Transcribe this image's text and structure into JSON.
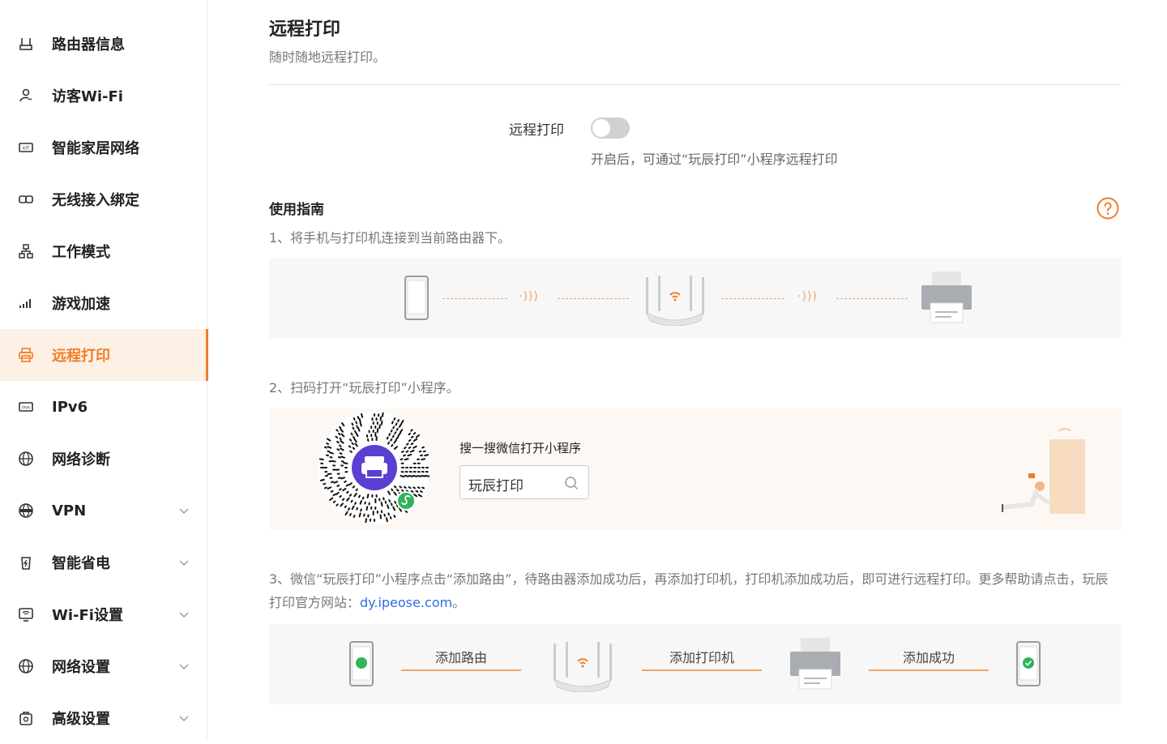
{
  "sidebar": {
    "items": [
      {
        "label": "路由器信息",
        "icon": "router-icon",
        "expandable": false,
        "active": false
      },
      {
        "label": "访客Wi-Fi",
        "icon": "guest-icon",
        "expandable": false,
        "active": false
      },
      {
        "label": "智能家居网络",
        "icon": "iot-icon",
        "expandable": false,
        "active": false
      },
      {
        "label": "无线接入绑定",
        "icon": "link-icon",
        "expandable": false,
        "active": false
      },
      {
        "label": "工作模式",
        "icon": "topology-icon",
        "expandable": false,
        "active": false
      },
      {
        "label": "游戏加速",
        "icon": "signal-bars-icon",
        "expandable": false,
        "active": false
      },
      {
        "label": "远程打印",
        "icon": "printer-icon",
        "expandable": false,
        "active": true
      },
      {
        "label": "IPv6",
        "icon": "ipv6-icon",
        "expandable": false,
        "active": false
      },
      {
        "label": "网络诊断",
        "icon": "globe-icon",
        "expandable": false,
        "active": false
      },
      {
        "label": "VPN",
        "icon": "vpn-globe-icon",
        "expandable": true,
        "active": false
      },
      {
        "label": "智能省电",
        "icon": "power-save-icon",
        "expandable": true,
        "active": false
      },
      {
        "label": "Wi-Fi设置",
        "icon": "wifi-settings-icon",
        "expandable": true,
        "active": false
      },
      {
        "label": "网络设置",
        "icon": "globe-icon",
        "expandable": true,
        "active": false
      },
      {
        "label": "高级设置",
        "icon": "advanced-settings-icon",
        "expandable": true,
        "active": false
      }
    ]
  },
  "page": {
    "title": "远程打印",
    "subtitle": "随时随地远程打印。"
  },
  "toggle": {
    "label": "远程打印",
    "enabled": false,
    "hint": "开启后，可通过“玩辰打印”小程序远程打印"
  },
  "guide": {
    "title": "使用指南",
    "step1": "1、将手机与打印机连接到当前路由器下。",
    "step2": "2、扫码打开“玩辰打印”小程序。",
    "qr_label": "搜一搜微信打开小程序",
    "search_text": "玩辰打印",
    "step3_text": "3、微信“玩辰打印”小程序点击“添加路由”，待路由器添加成功后，再添加打印机，打印机添加成功后，即可进行远程打印。更多帮助请点击，玩辰打印官方网站：",
    "step3_link": "dy.ipeose.com",
    "step3_end": "。",
    "flow": [
      "添加路由",
      "添加打印机",
      "添加成功"
    ]
  },
  "colors": {
    "accent": "#f07d28",
    "link": "#2d6fdc",
    "active_bg": "#fdf0e5",
    "qr_purple": "#5b3fd1",
    "success_green": "#2fb45a"
  }
}
